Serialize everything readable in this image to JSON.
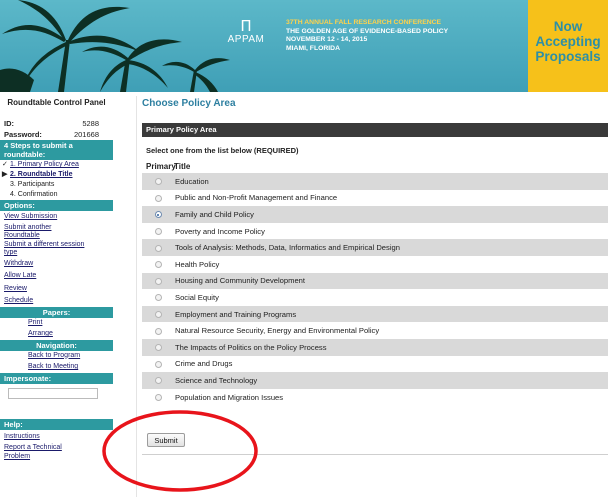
{
  "banner": {
    "logo_text": "APPAM",
    "logo_glyph": "Π",
    "conference_line1": "37TH ANNUAL FALL RESEARCH CONFERENCE",
    "conference_line2": "THE GOLDEN AGE OF EVIDENCE-BASED POLICY",
    "conference_line3": "NOVEMBER 12 - 14, 2015",
    "conference_line4": "MIAMI, FLORIDA",
    "callout_line1": "Now",
    "callout_line2": "Accepting",
    "callout_line3": "Proposals"
  },
  "sidebar": {
    "title": "Roundtable Control Panel",
    "id_label": "ID:",
    "id_value": "5288",
    "password_label": "Password:",
    "password_value": "201668",
    "steps_header": "4 Steps to submit a roundtable:",
    "steps": [
      {
        "mark": "✓",
        "label": "1. Primary Policy Area",
        "link": true,
        "current": false
      },
      {
        "mark": "▶",
        "label": "2. Roundtable Title",
        "link": true,
        "current": true
      },
      {
        "mark": "",
        "label": "3. Participants",
        "link": false,
        "current": false
      },
      {
        "mark": "",
        "label": "4. Confirmation",
        "link": false,
        "current": false
      }
    ],
    "options_header": "Options:",
    "options": [
      "View Submission",
      "Submit another Roundtable",
      "Submit a different session type",
      "Withdraw",
      "Allow Late",
      "Review",
      "Schedule"
    ],
    "papers_header": "Papers:",
    "papers": [
      "Print",
      "Arrange"
    ],
    "navigation_header": "Navigation:",
    "navigation": [
      "Back to Program",
      "Back to Meeting"
    ],
    "impersonate_header": "Impersonate:",
    "help_header": "Help:",
    "help": [
      "Instructions",
      "Report a Technical Problem"
    ]
  },
  "main": {
    "page_title": "Choose Policy Area",
    "panel_header": "Primary Policy Area",
    "instruction": "Select one from the list below (REQUIRED)",
    "col_primary": "Primary",
    "col_title": "Title",
    "selected_index": 2,
    "options": [
      "Education",
      "Public and Non-Profit Management and Finance",
      "Family and Child Policy",
      "Poverty and Income Policy",
      "Tools of Analysis: Methods, Data, Informatics and Empirical Design",
      "Health Policy",
      "Housing and Community Development",
      "Social Equity",
      "Employment and Training Programs",
      "Natural Resource Security, Energy and Environmental Policy",
      "The Impacts of Politics on the Policy Process",
      "Crime and Drugs",
      "Science and Technology",
      "Population and Migration Issues"
    ],
    "submit_label": "Submit"
  },
  "colors": {
    "banner_teal": "#47a8bd",
    "callout_yellow": "#f6c11a",
    "sidebar_header_teal": "#2d9aa0",
    "panel_header_dark": "#3a3a3a",
    "annotation_red": "#e8141b"
  }
}
